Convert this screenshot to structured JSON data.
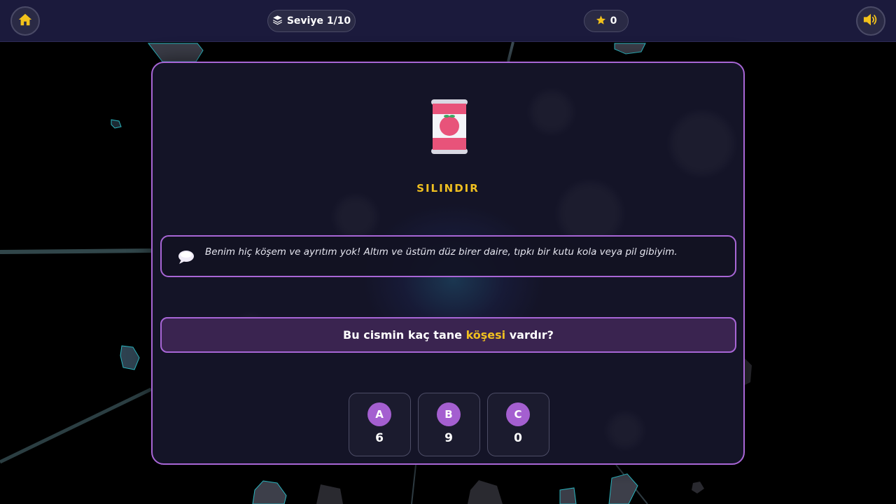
{
  "header": {
    "home_icon": "home-icon",
    "level_icon": "layers-icon",
    "level_label": "Seviye 1/10",
    "score_icon": "star-icon",
    "score_value": "0",
    "sound_icon": "volume-icon"
  },
  "card": {
    "object_icon": "tomato-can-icon",
    "shape_name": "SILINDIR",
    "hint_icon": "speech-bubble-icon",
    "hint_text": "Benim hiç köşem ve ayrıtım yok! Altım ve üstüm düz birer daire, tıpkı bir kutu kola veya pil gibiyim.",
    "question_before": "Bu cismin kaç tane ",
    "question_highlight": "köşesi",
    "question_after": " vardır?",
    "options": [
      {
        "letter": "A",
        "value": "6"
      },
      {
        "letter": "B",
        "value": "9"
      },
      {
        "letter": "C",
        "value": "0"
      }
    ]
  },
  "colors": {
    "accent": "#a866d6",
    "highlight": "#f0c020",
    "topbar": "#1b1a3c",
    "option_badge": "#a45fd0"
  }
}
